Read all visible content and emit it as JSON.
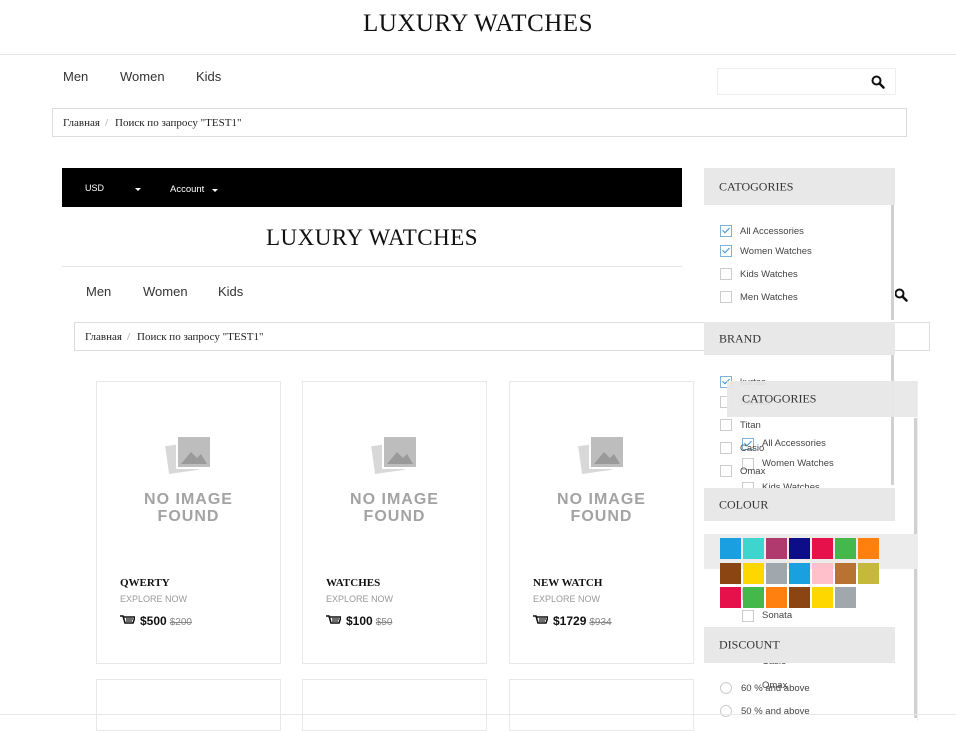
{
  "outer": {
    "logo": "LUXURY WATCHES",
    "nav": [
      "Men",
      "Women",
      "Kids"
    ],
    "breadcrumb": {
      "home": "Главная",
      "sep": "/",
      "current": "Поиск по запросу \"TEST1\""
    }
  },
  "inner": {
    "topbar": {
      "currency": "USD",
      "account": "Account"
    },
    "logo": "LUXURY WATCHES",
    "nav": [
      "Men",
      "Women",
      "Kids"
    ],
    "breadcrumb": {
      "home": "Главная",
      "sep": "/",
      "current": "Поиск по запросу \"TEST1\""
    }
  },
  "noimage": {
    "line1": "NO IMAGE",
    "line2": "FOUND"
  },
  "products": [
    {
      "name": "QWERTY",
      "explore": "EXPLORE NOW",
      "price": "$500",
      "old_price": "$200"
    },
    {
      "name": "WATCHES",
      "explore": "EXPLORE NOW",
      "price": "$100",
      "old_price": "$50"
    },
    {
      "name": "NEW WATCH",
      "explore": "EXPLORE NOW",
      "price": "$1729",
      "old_price": "$934"
    }
  ],
  "sidebar": {
    "categories": {
      "title": "CATOGORIES",
      "items": [
        {
          "label": "All Accessories",
          "checked": true
        },
        {
          "label": "Women Watches",
          "checked": true
        },
        {
          "label": "Kids Watches",
          "checked": false
        },
        {
          "label": "Men Watches",
          "checked": false
        }
      ]
    },
    "brand": {
      "title": "BRAND",
      "items": [
        {
          "label": "kurtas",
          "checked": true
        },
        {
          "label": "Sonata",
          "checked": false
        },
        {
          "label": "Titan",
          "checked": false
        },
        {
          "label": "Casio",
          "checked": false
        },
        {
          "label": "Omax",
          "checked": false
        }
      ]
    },
    "colour": {
      "title": "COLOUR",
      "swatches": [
        "#1a9fe0",
        "#3fd5cf",
        "#b03a6e",
        "#0d0d8a",
        "#e6104a",
        "#44b84a",
        "#ff7f0f",
        "#8b4513",
        "#ffd700",
        "#a0a8ad",
        "#1a9fe0",
        "#ffc0cb",
        "#b87333",
        "#c5b83a",
        "#e6104a",
        "#44b84a",
        "#ff7f0f",
        "#8b4513",
        "#ffd700",
        "#a0a8ad"
      ]
    },
    "discount": {
      "title": "DISCOUNT",
      "items": [
        "60 % and above",
        "50 % and above"
      ]
    }
  },
  "overlay": {
    "categories_title": "CATOGORIES",
    "items": [
      "All Accessories",
      "Women Watches",
      "Kids Watches"
    ],
    "brand_fragments": [
      "Sonata",
      "Casio",
      "Omax"
    ]
  }
}
